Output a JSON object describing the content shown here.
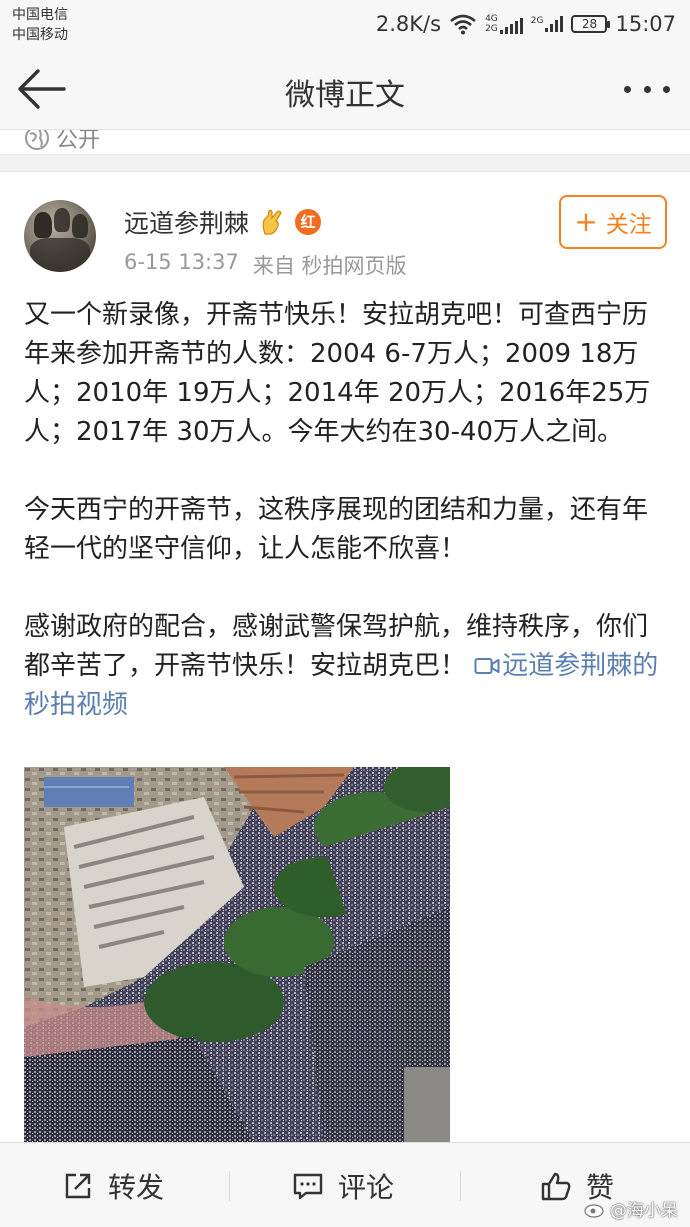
{
  "status_bar": {
    "carrier_1": "中国电信",
    "carrier_2": "中国移动",
    "net_speed": "2.8K/s",
    "sig1_label_top": "4G",
    "sig1_label_bottom": "2G",
    "sig2_label": "2G",
    "battery": "28",
    "time": "15:07"
  },
  "nav": {
    "title": "微博正文",
    "back_icon": "back-arrow-icon",
    "more_icon": "more-dots-icon"
  },
  "visibility": {
    "label": "公开",
    "icon": "globe-icon"
  },
  "post": {
    "author": "远道参荆棘",
    "badge_text": "红",
    "timestamp": "6-15 13:37",
    "source": "来自 秒拍网页版",
    "follow_label": "关注",
    "para1": "又一个新录像，开斋节快乐！安拉胡克吧！可查西宁历年来参加开斋节的人数：2004 6-7万人；2009 18万人；2010年 19万人；2014年 20万人；2016年25万人；2017年 30万人。今年大约在30-40万人之间。",
    "para2": "今天西宁的开斋节，这秩序展现的团结和力量，还有年轻一代的坚守信仰，让人怎能不欣喜！",
    "para3": "感谢政府的配合，感谢武警保驾护航，维持秩序，你们都辛苦了，开斋节快乐！安拉胡克巴！",
    "video_link": "远道参荆棘的秒拍视频"
  },
  "bottom_bar": {
    "repost": "转发",
    "comment": "评论",
    "like": "赞"
  },
  "watermark": "@海小呆",
  "colors": {
    "accent_orange": "#f58220",
    "link_blue": "#5b7fb0",
    "badge_red": "#f26b1f"
  }
}
